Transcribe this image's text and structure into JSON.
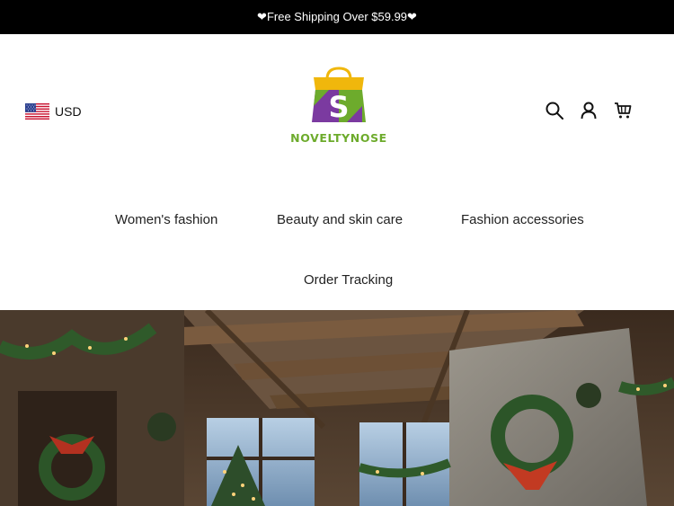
{
  "announcement": {
    "text": "❤Free Shipping Over $59.99❤"
  },
  "header": {
    "currency": {
      "code": "USD",
      "flag_icon": "us-flag-icon"
    },
    "logo": {
      "letter": "S",
      "text": "NOVELTYNOSE"
    },
    "icons": [
      "search-icon",
      "account-icon",
      "cart-icon"
    ]
  },
  "nav": {
    "items": [
      "Women's fashion",
      "Beauty and skin care",
      "Fashion accessories",
      "Order Tracking"
    ]
  },
  "colors": {
    "announcement_bg": "#000000",
    "logo_green": "#6dab2c",
    "logo_purple": "#7b3aa0",
    "logo_yellow": "#f0b70c"
  }
}
